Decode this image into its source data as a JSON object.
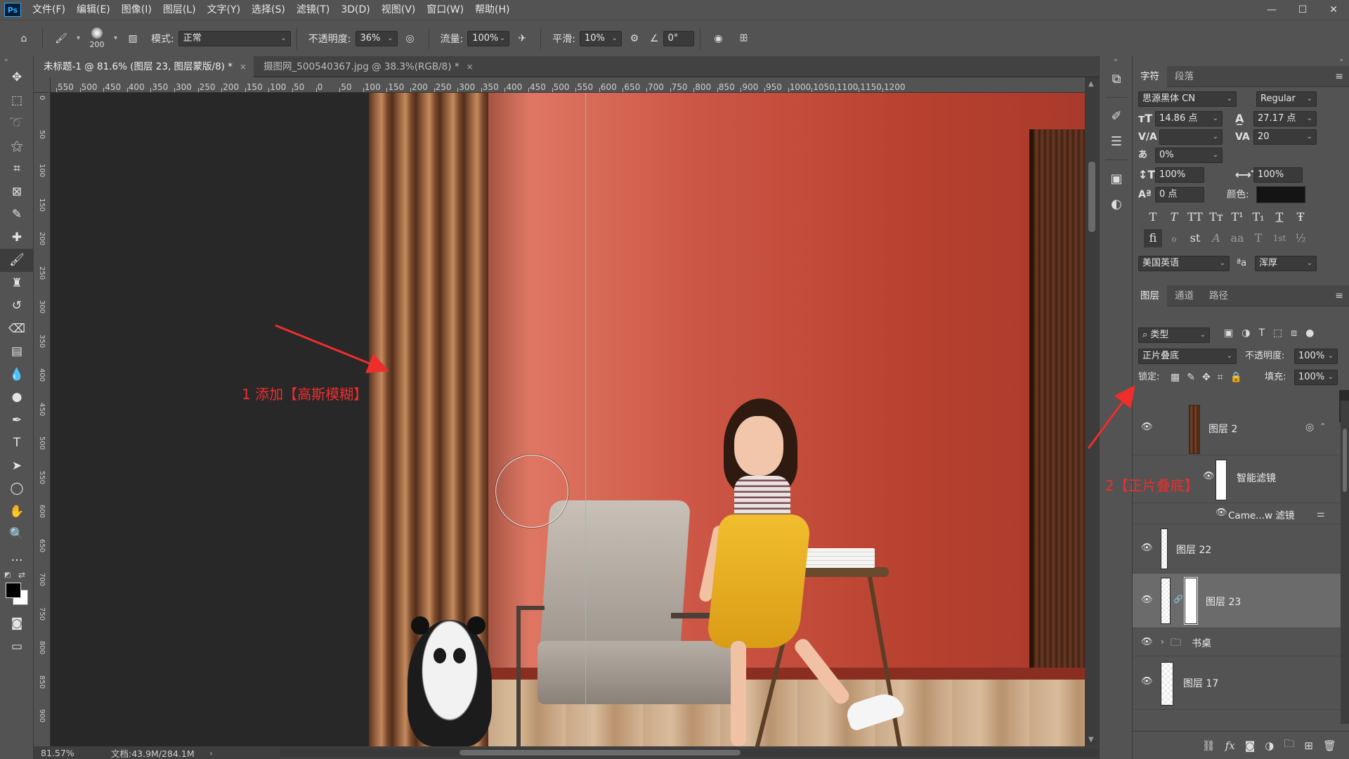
{
  "menubar": {
    "logo": "Ps",
    "items": [
      "文件(F)",
      "编辑(E)",
      "图像(I)",
      "图层(L)",
      "文字(Y)",
      "选择(S)",
      "滤镜(T)",
      "3D(D)",
      "视图(V)",
      "窗口(W)",
      "帮助(H)"
    ],
    "controls": [
      "—",
      "☐",
      "✕"
    ]
  },
  "options": {
    "brush_size": "200",
    "mode_label": "模式:",
    "mode_value": "正常",
    "opacity_label": "不透明度:",
    "opacity_value": "36%",
    "flow_label": "流量:",
    "flow_value": "100%",
    "smooth_label": "平滑:",
    "smooth_value": "10%",
    "angle_value": "0°"
  },
  "tabs": [
    {
      "label": "未标题-1 @ 81.6% (图层 23, 图层蒙版/8) *",
      "close": "×"
    },
    {
      "label": "摄图网_500540367.jpg @ 38.3%(RGB/8) *",
      "close": "×"
    }
  ],
  "ruler": {
    "top_ticks": [
      "550",
      "500",
      "450",
      "400",
      "350",
      "300",
      "250",
      "200",
      "150",
      "100",
      "50",
      "0",
      "50",
      "100",
      "150",
      "200",
      "250",
      "300",
      "350",
      "400",
      "450",
      "500",
      "550",
      "600",
      "650",
      "700",
      "750",
      "800",
      "850",
      "900",
      "950",
      "1000",
      "1050",
      "1100",
      "1150",
      "1200"
    ],
    "left_ticks": [
      "0",
      "50",
      "100",
      "150",
      "200",
      "250",
      "300",
      "350",
      "400",
      "450",
      "500",
      "550",
      "600",
      "650",
      "700",
      "750",
      "800",
      "850",
      "900"
    ]
  },
  "annotations": {
    "step1": "1 添加【高斯模糊】",
    "step2": "2【正片叠底】"
  },
  "status": {
    "zoom": "81.57%",
    "doc": "文档:43.9M/284.1M",
    "arrow": "›"
  },
  "character_panel": {
    "tabs": [
      "字符",
      "段落"
    ],
    "font_family": "思源黑体 CN",
    "font_style": "Regular",
    "font_size": "14.86 点",
    "leading": "27.17 点",
    "kerning": "",
    "tracking": "20",
    "tsume": "0%",
    "vscale": "100%",
    "hscale": "100%",
    "baseline": "0 点",
    "color_label": "颜色:",
    "language": "美国英语",
    "aa_label": "ªa",
    "antialias": "浑厚",
    "style_buttons": [
      "T",
      "T",
      "TT",
      "Tт",
      "T¹",
      "T₁",
      "T",
      "Ŧ"
    ],
    "opentype_buttons": [
      "fi",
      "ℴ",
      "st",
      "A",
      "aa",
      "T",
      "1st",
      "½"
    ]
  },
  "layers_panel": {
    "tabs": [
      "图层",
      "通道",
      "路径"
    ],
    "filter_label": "类型",
    "blend_mode": "正片叠底",
    "opacity_label": "不透明度:",
    "opacity_value": "100%",
    "lock_label": "锁定:",
    "fill_label": "填充:",
    "fill_value": "100%",
    "layers": [
      {
        "name": "图层 2",
        "thumb": "wood"
      },
      {
        "name": "智能滤镜",
        "thumb": "mask"
      },
      {
        "name": "Came...w 滤镜",
        "thumb": "none"
      },
      {
        "name": "图层 22",
        "thumb": "strip"
      },
      {
        "name": "图层 23",
        "thumb": "strip-mask"
      },
      {
        "name": "书桌",
        "thumb": "folder"
      },
      {
        "name": "图层 17",
        "thumb": "checker"
      }
    ]
  },
  "colors": {
    "accent_red": "#ef2d2d",
    "guide": "#58d5d9",
    "panel": "#535353",
    "wall": "#c75a48"
  }
}
